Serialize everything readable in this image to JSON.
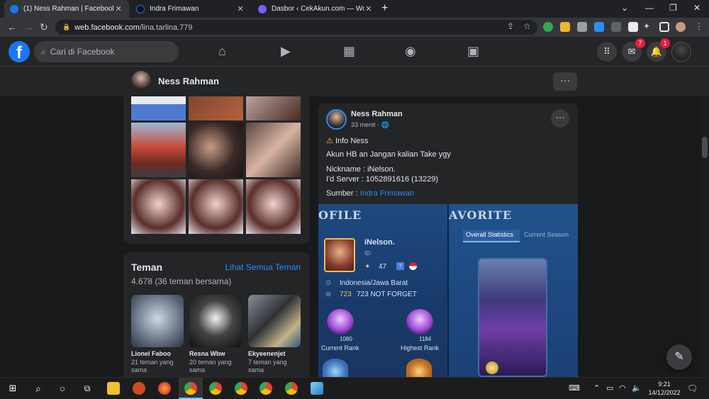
{
  "browser": {
    "tabs": [
      {
        "title": "(1) Ness Rahman | Facebook",
        "active": true
      },
      {
        "title": "Indra Frimawan",
        "active": false
      },
      {
        "title": "Dasbor ‹ CekAkun.com — WordP",
        "active": false
      }
    ],
    "new_tab": "+",
    "url_host": "web.facebook.com",
    "url_path": "/lina.tarlina.779"
  },
  "facebook": {
    "logo": "f",
    "search_placeholder": "Cari di Facebook",
    "nav_icons": [
      "home-icon",
      "watch-icon",
      "marketplace-icon",
      "groups-icon",
      "gaming-icon"
    ],
    "messenger_badge": "7",
    "notifications_badge": "1"
  },
  "profile_header": {
    "name": "Ness Rahman",
    "more": "···"
  },
  "friends": {
    "title": "Teman",
    "see_all": "Lihat Semua Teman",
    "count": "4.678 (36 teman bersama)",
    "items": [
      {
        "name": "Lionel Faboo",
        "mutual": "21 teman yang sama"
      },
      {
        "name": "Resna Wbw",
        "mutual": "20 teman yang sama"
      },
      {
        "name": "Ekyeenenjet",
        "mutual": "7 teman yang sama"
      }
    ]
  },
  "post": {
    "author": "Ness Rahman",
    "time": "33 menit · 🌐",
    "line1": "Info Ness",
    "line2": "Akun HB an Jangan kalian Take ygy",
    "line3": "Nickname : iNelson.",
    "line4": "I'd Server : 1052891616 (13229)",
    "source_label": "Sumber : ",
    "source_link": "Indra Frimawan"
  },
  "game": {
    "left_header": "OFILE",
    "right_header": "AVORITE",
    "nickname": "iNelson.",
    "id_label": "ID:",
    "level": "47",
    "region": "Indonesia/Jawa Barat",
    "points": "723",
    "motto": "723 NOT FORGET",
    "current_rank_points": "1080",
    "current_rank_label": "Current Rank",
    "highest_rank_points": "1184",
    "highest_rank_label": "Highest Rank",
    "tab_overall": "Overall Statistics",
    "tab_season": "Current Season"
  },
  "taskbar": {
    "time": "9:21",
    "date": "14/12/2022"
  }
}
